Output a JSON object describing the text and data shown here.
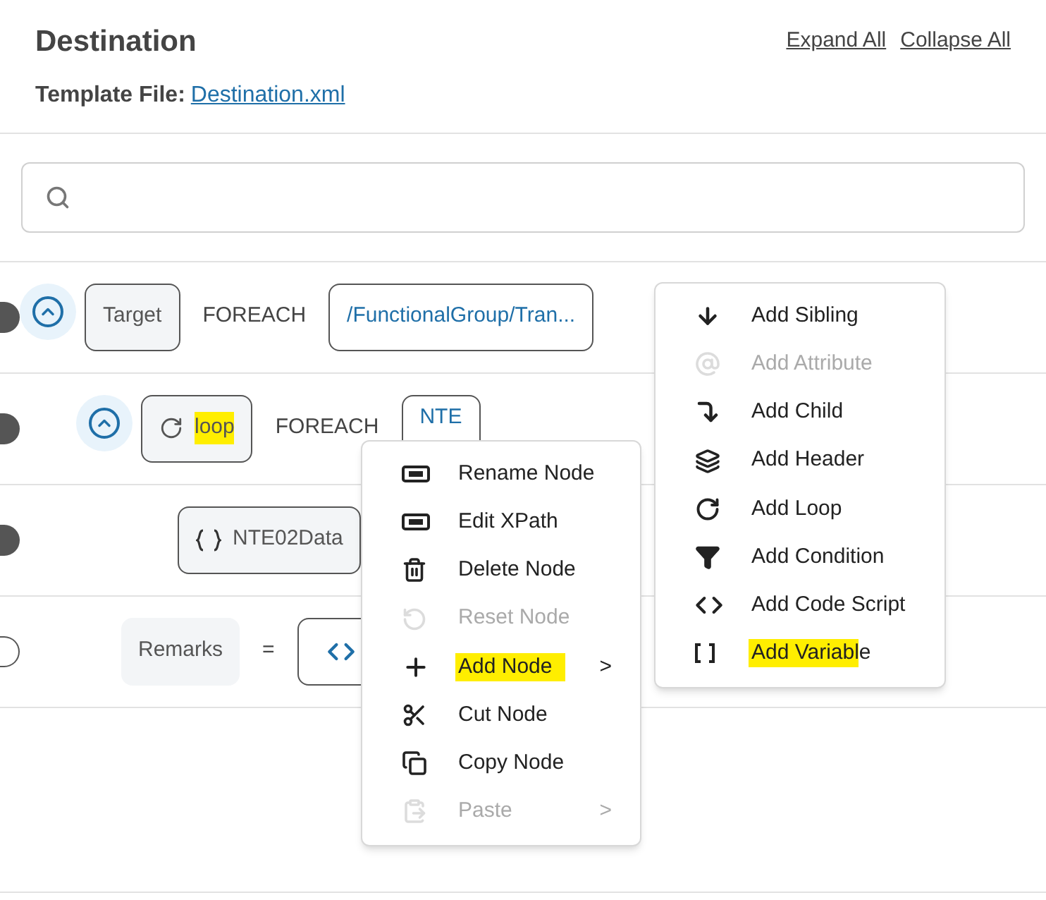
{
  "header": {
    "title": "Destination",
    "template_label": "Template File:",
    "template_file": "Destination.xml",
    "links": [
      "Expand All",
      "Collapse All"
    ]
  },
  "rows": [
    {
      "kind": "foreach",
      "expanded": true,
      "node": "Target",
      "highlighted": false,
      "operator": "FOREACH",
      "value": "/FunctionalGroup/Tran..."
    },
    {
      "kind": "loop",
      "expanded": true,
      "node": "loop",
      "highlighted": true,
      "operator": "FOREACH",
      "value": "NTE"
    },
    {
      "kind": "variable",
      "node": "NTE02Data",
      "highlighted": false
    },
    {
      "kind": "assign",
      "node": "Remarks",
      "highlighted": false,
      "operator": "="
    }
  ],
  "context_menu": [
    {
      "label": "Rename Node",
      "disabled": false,
      "highlighted": false
    },
    {
      "label": "Edit XPath",
      "disabled": false,
      "highlighted": false
    },
    {
      "label": "Delete Node",
      "disabled": false,
      "highlighted": false
    },
    {
      "label": "Reset Node",
      "disabled": true,
      "highlighted": false
    },
    {
      "label": "Add Node",
      "disabled": false,
      "highlighted": true,
      "submenu": ">"
    },
    {
      "label": "Cut Node",
      "disabled": false,
      "highlighted": false
    },
    {
      "label": "Copy Node",
      "disabled": false,
      "highlighted": false
    },
    {
      "label": "Paste",
      "disabled": true,
      "highlighted": false,
      "submenu": ">"
    }
  ],
  "submenu": [
    {
      "label": "Add Sibling",
      "disabled": false,
      "highlighted": false
    },
    {
      "label": "Add Attribute",
      "disabled": true,
      "highlighted": false
    },
    {
      "label": "Add Child",
      "disabled": false,
      "highlighted": false
    },
    {
      "label": "Add Header",
      "disabled": false,
      "highlighted": false
    },
    {
      "label": "Add Loop",
      "disabled": false,
      "highlighted": false
    },
    {
      "label": "Add Condition",
      "disabled": false,
      "highlighted": false
    },
    {
      "label": "Add Code Script",
      "disabled": false,
      "highlighted": false
    },
    {
      "label": "Add Variable",
      "disabled": false,
      "highlighted": true
    }
  ]
}
